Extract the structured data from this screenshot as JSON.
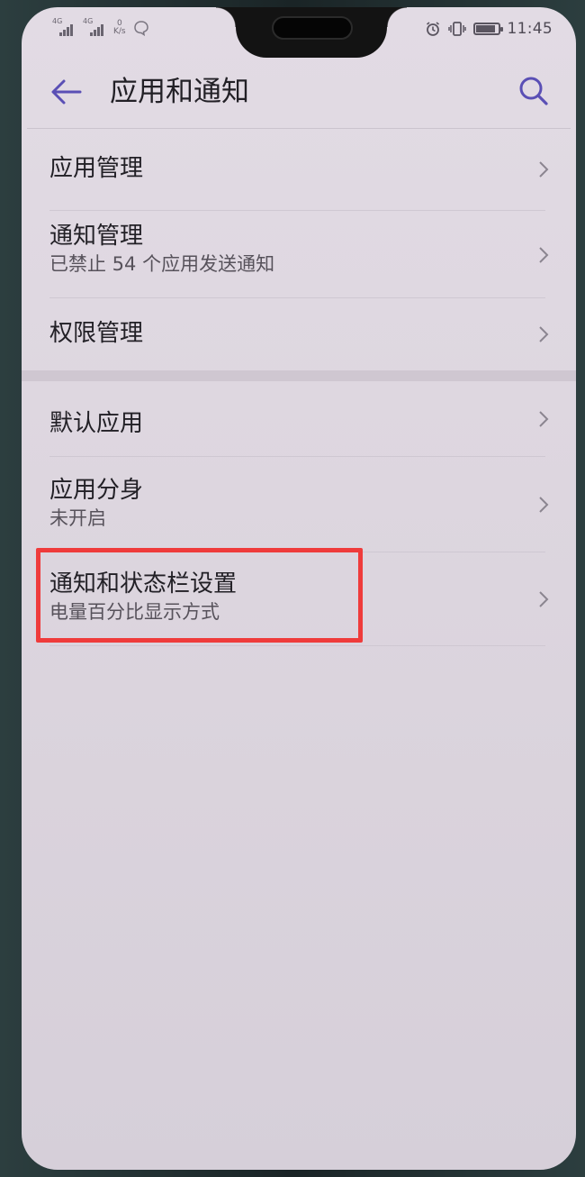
{
  "status_bar": {
    "sim1_tag": "4G",
    "sim2_tag": "4G",
    "speed_value": "0",
    "speed_unit": "K/s",
    "time": "11:45",
    "battery_level": 0.8
  },
  "header": {
    "title": "应用和通知"
  },
  "groups": [
    {
      "items": [
        {
          "label": "应用管理",
          "sub": ""
        },
        {
          "label": "通知管理",
          "sub": "已禁止 54 个应用发送通知"
        },
        {
          "label": "权限管理",
          "sub": ""
        }
      ]
    },
    {
      "items": [
        {
          "label": "默认应用",
          "sub": ""
        },
        {
          "label": "应用分身",
          "sub": "未开启"
        },
        {
          "label": "通知和状态栏设置",
          "sub": "电量百分比显示方式"
        }
      ]
    }
  ],
  "colors": {
    "accent": "#5a4fb5",
    "highlight": "#ef3b3b",
    "background": "#dcd5de",
    "text_primary": "#222026"
  },
  "icons": {
    "back": "arrow-left-icon",
    "search": "search-icon",
    "chevron": "chevron-right-icon",
    "alarm": "alarm-icon",
    "vibrate": "vibrate-icon",
    "battery": "battery-icon",
    "signal": "signal-icon",
    "message": "message-bubble-icon"
  }
}
